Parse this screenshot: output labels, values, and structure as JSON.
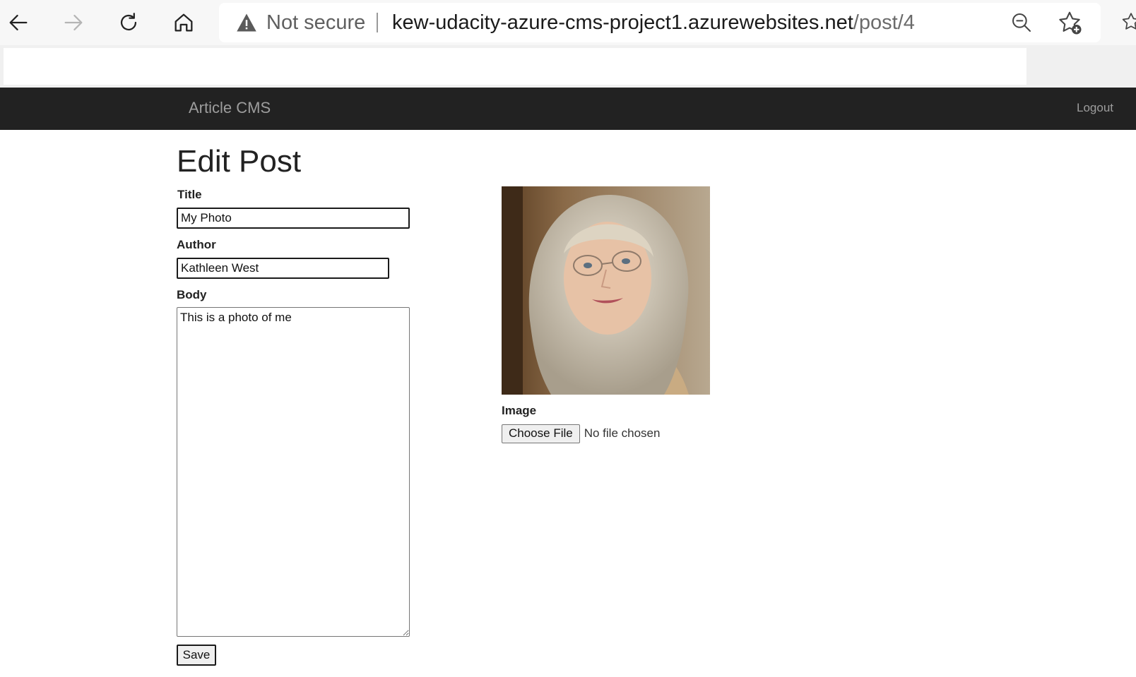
{
  "browser": {
    "security_label": "Not secure",
    "url_host": "kew-udacity-azure-cms-project1.azurewebsites.net",
    "url_path": "/post/4",
    "icons": [
      "back-arrow-icon",
      "forward-arrow-icon",
      "refresh-icon",
      "home-icon",
      "warning-icon",
      "zoom-out-icon",
      "add-favorite-icon",
      "favorites-icon"
    ]
  },
  "navbar": {
    "brand": "Article CMS",
    "logout": "Logout",
    "background": "#222222",
    "text_color": "#9d9d9d"
  },
  "page": {
    "title": "Edit Post"
  },
  "form": {
    "title_label": "Title",
    "title_value": "My Photo",
    "author_label": "Author",
    "author_value": "Kathleen West",
    "body_label": "Body",
    "body_value": "This is a photo of me",
    "image_label": "Image",
    "choose_file_label": "Choose File",
    "file_status": "No file chosen",
    "save_label": "Save"
  }
}
